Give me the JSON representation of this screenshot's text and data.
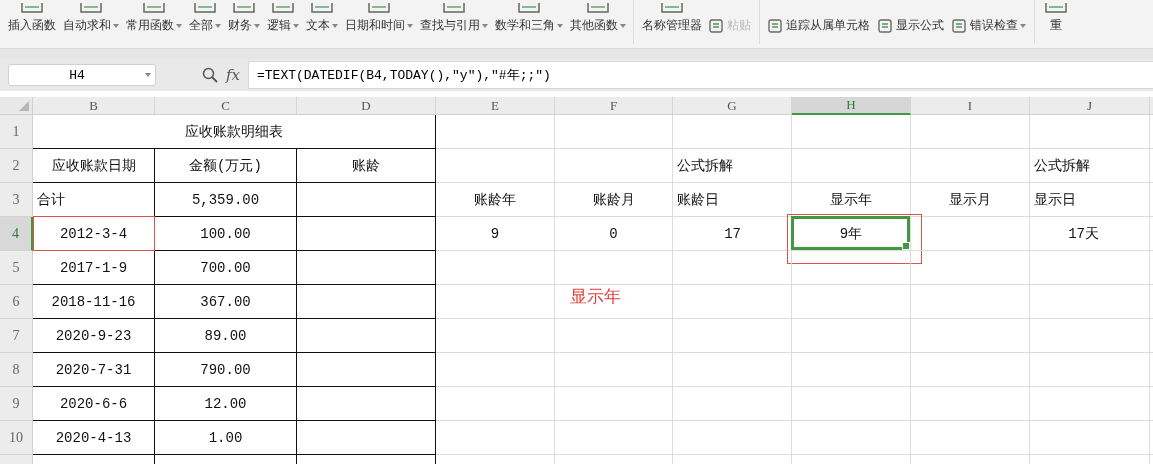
{
  "ribbon": {
    "items": [
      {
        "label": "插入函数",
        "kind": "large",
        "dropdown": false,
        "disabled": false
      },
      {
        "label": "自动求和",
        "kind": "large",
        "dropdown": true,
        "disabled": false
      },
      {
        "label": "常用函数",
        "kind": "large",
        "dropdown": true,
        "disabled": false
      },
      {
        "label": "全部",
        "kind": "large",
        "dropdown": true,
        "disabled": false
      },
      {
        "label": "财务",
        "kind": "large",
        "dropdown": true,
        "disabled": false
      },
      {
        "label": "逻辑",
        "kind": "large",
        "dropdown": true,
        "disabled": false
      },
      {
        "label": "文本",
        "kind": "large",
        "dropdown": true,
        "disabled": false
      },
      {
        "label": "日期和时间",
        "kind": "large",
        "dropdown": true,
        "disabled": false
      },
      {
        "label": "查找与引用",
        "kind": "large",
        "dropdown": true,
        "disabled": false
      },
      {
        "label": "数学和三角",
        "kind": "large",
        "dropdown": true,
        "disabled": false
      },
      {
        "label": "其他函数",
        "kind": "large",
        "dropdown": true,
        "disabled": false
      },
      {
        "label": "名称管理器",
        "kind": "large",
        "dropdown": false,
        "disabled": false
      },
      {
        "label": "粘贴",
        "kind": "small",
        "dropdown": false,
        "disabled": true
      },
      {
        "label": "追踪从属单元格",
        "kind": "small",
        "dropdown": false,
        "disabled": false
      },
      {
        "label": "显示公式",
        "kind": "small",
        "dropdown": false,
        "disabled": false
      },
      {
        "label": "错误检查",
        "kind": "small",
        "dropdown": true,
        "disabled": false
      },
      {
        "label": "重",
        "kind": "large",
        "dropdown": false,
        "disabled": false
      }
    ]
  },
  "formula_bar": {
    "name_box": "H4",
    "fx_label": "fx",
    "formula": "=TEXT(DATEDIF(B4,TODAY(),\"y\"),\"#年;;\")"
  },
  "columns": [
    {
      "label": "B",
      "selected": false
    },
    {
      "label": "C",
      "selected": false
    },
    {
      "label": "D",
      "selected": false
    },
    {
      "label": "E",
      "selected": false
    },
    {
      "label": "F",
      "selected": false
    },
    {
      "label": "G",
      "selected": false
    },
    {
      "label": "H",
      "selected": true
    },
    {
      "label": "I",
      "selected": false
    },
    {
      "label": "J",
      "selected": false
    }
  ],
  "rows": [
    {
      "number": "1",
      "selected": false,
      "cells": {
        "B": {
          "text": "应收账款明细表",
          "kind": "title"
        }
      }
    },
    {
      "number": "2",
      "selected": false,
      "cells": {
        "B": {
          "text": "应收账款日期",
          "kind": "center"
        },
        "C": {
          "text": "金额(万元)",
          "kind": "center"
        },
        "D": {
          "text": "账龄",
          "kind": "center"
        },
        "G": {
          "text": "公式拆解",
          "kind": "left"
        },
        "J": {
          "text": "公式拆解",
          "kind": "left"
        }
      }
    },
    {
      "number": "3",
      "selected": false,
      "cells": {
        "B": {
          "text": "合计",
          "kind": "left"
        },
        "C": {
          "text": "5,359.00",
          "kind": "center"
        },
        "E": {
          "text": "账龄年",
          "kind": "center"
        },
        "F": {
          "text": "账龄月",
          "kind": "center"
        },
        "G": {
          "text": "账龄日",
          "kind": "left"
        },
        "H": {
          "text": "显示年",
          "kind": "center"
        },
        "I": {
          "text": "显示月",
          "kind": "center"
        },
        "J": {
          "text": "显示日",
          "kind": "left"
        }
      }
    },
    {
      "number": "4",
      "selected": true,
      "cells": {
        "B": {
          "text": "2012-3-4",
          "kind": "center",
          "marked": true
        },
        "C": {
          "text": "100.00",
          "kind": "center"
        },
        "E": {
          "text": "9",
          "kind": "center"
        },
        "F": {
          "text": "0",
          "kind": "center"
        },
        "G": {
          "text": "17",
          "kind": "right"
        },
        "H": {
          "text": "9年",
          "kind": "center",
          "active": true,
          "marked": true
        },
        "J": {
          "text": "17天",
          "kind": "right"
        }
      }
    },
    {
      "number": "5",
      "selected": false,
      "cells": {
        "B": {
          "text": "2017-1-9",
          "kind": "center"
        },
        "C": {
          "text": "700.00",
          "kind": "center"
        }
      }
    },
    {
      "number": "6",
      "selected": false,
      "cells": {
        "B": {
          "text": "2018-11-16",
          "kind": "center"
        },
        "C": {
          "text": "367.00",
          "kind": "center"
        },
        "F": {
          "text": "显示年",
          "kind": "note"
        }
      }
    },
    {
      "number": "7",
      "selected": false,
      "cells": {
        "B": {
          "text": "2020-9-23",
          "kind": "center"
        },
        "C": {
          "text": "89.00",
          "kind": "center"
        }
      }
    },
    {
      "number": "8",
      "selected": false,
      "cells": {
        "B": {
          "text": "2020-7-31",
          "kind": "center"
        },
        "C": {
          "text": "790.00",
          "kind": "center"
        }
      }
    },
    {
      "number": "9",
      "selected": false,
      "cells": {
        "B": {
          "text": "2020-6-6",
          "kind": "center"
        },
        "C": {
          "text": "12.00",
          "kind": "center"
        }
      }
    },
    {
      "number": "10",
      "selected": false,
      "cells": {
        "B": {
          "text": "2020-4-13",
          "kind": "center"
        },
        "C": {
          "text": "1.00",
          "kind": "center"
        }
      }
    }
  ]
}
